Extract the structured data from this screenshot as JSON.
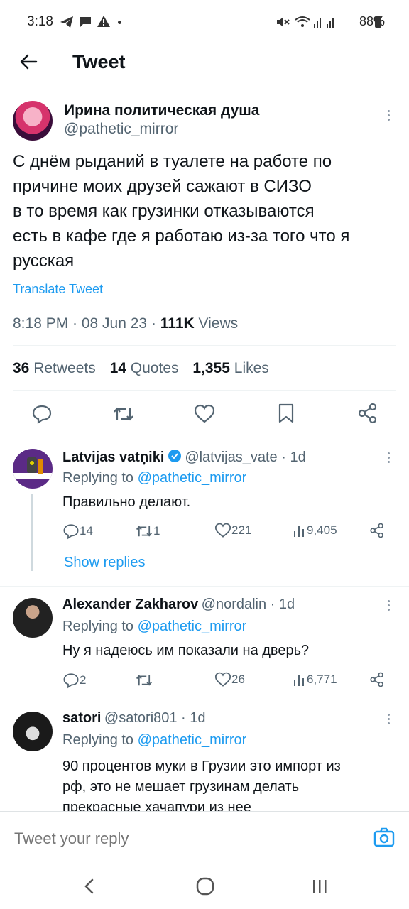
{
  "status_bar": {
    "time": "3:18",
    "battery": "88%"
  },
  "header": {
    "title": "Tweet"
  },
  "main_tweet": {
    "author_name": "Ирина политическая душа",
    "handle": "@pathetic_mirror",
    "text_lines": [
      "С днём рыданий в туалете на работе по",
      "причине моих друзей сажают в СИЗО",
      "в то время как грузинки отказываются",
      "есть в кафе где я работаю из-за того что я",
      "русская"
    ],
    "translate": "Translate Tweet",
    "timestamp": "8:18 PM · 08 Jun 23 · ",
    "views_count": "111K",
    "views_label": " Views",
    "stats": {
      "retweets_count": "36",
      "retweets_label": "Retweets",
      "quotes_count": "14",
      "quotes_label": "Quotes",
      "likes_count": "1,355",
      "likes_label": "Likes"
    }
  },
  "replies": [
    {
      "name": "Latvijas vatņiki",
      "handle": "@latvijas_vate · 1d",
      "replying_prefix": "Replying to ",
      "replying_to": "@pathetic_mirror",
      "text": "Правильно делают.",
      "replies": "14",
      "retweets": "1",
      "likes": "221",
      "views": "9,405",
      "show_replies": "Show replies"
    },
    {
      "name": "Alexander Zakharov",
      "handle": "@nordalin · 1d",
      "replying_prefix": "Replying to ",
      "replying_to": "@pathetic_mirror",
      "text": "Ну я надеюсь им показали на дверь?",
      "replies": "2",
      "retweets": "",
      "likes": "26",
      "views": "6,771"
    },
    {
      "name": "satori",
      "handle": "@satori801 · 1d",
      "replying_prefix": "Replying to ",
      "replying_to": "@pathetic_mirror",
      "text_lines": [
        "90 процентов муки в Грузии это импорт из",
        "рф, это не мешает грузинам делать",
        "прекрасные хачапури из нее"
      ]
    }
  ],
  "reply_input": {
    "placeholder": "Tweet your reply"
  },
  "colors": {
    "accent": "#1d9bf0",
    "muted": "#536471",
    "text": "#0f1419"
  }
}
